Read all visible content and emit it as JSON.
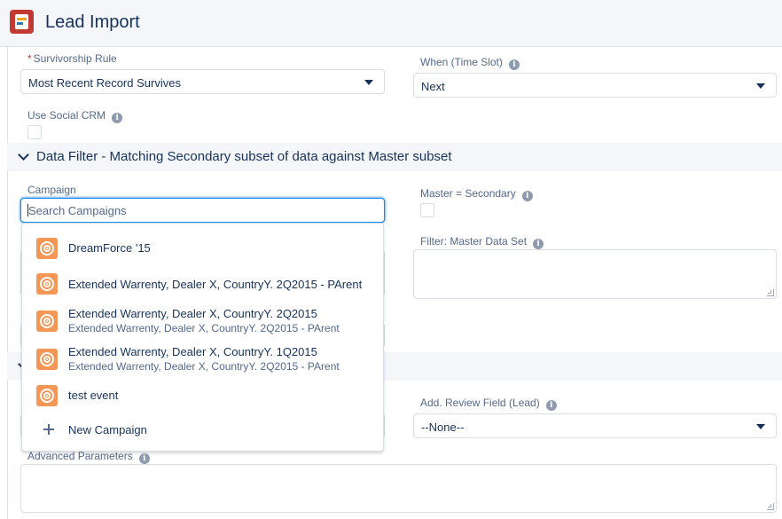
{
  "header": {
    "title": "Lead Import"
  },
  "survivorship": {
    "required_mark": "*",
    "label": "Survivorship Rule",
    "value": "Most Recent Record Survives"
  },
  "time_slot": {
    "label": "When (Time Slot)",
    "value": "Next"
  },
  "social": {
    "label": "Use Social CRM"
  },
  "data_filter": {
    "title": "Data Filter - Matching Secondary subset of data against Master subset"
  },
  "campaign": {
    "label": "Campaign",
    "placeholder": "Search Campaigns",
    "options": [
      {
        "title": "DreamForce '15",
        "subtitle": ""
      },
      {
        "title": "Extended Warrenty, Dealer X, CountryY. 2Q2015 - PArent",
        "subtitle": ""
      },
      {
        "title": "Extended Warrenty, Dealer X, CountryY. 2Q2015",
        "subtitle": "Extended Warrenty, Dealer X, CountryY. 2Q2015 - PArent"
      },
      {
        "title": "Extended Warrenty, Dealer X, CountryY. 1Q2015",
        "subtitle": "Extended Warrenty, Dealer X, CountryY. 2Q2015 - PArent"
      },
      {
        "title": "test event",
        "subtitle": ""
      }
    ],
    "new_label": "New Campaign"
  },
  "master_secondary": {
    "label": "Master = Secondary"
  },
  "filter_master": {
    "label": "Filter: Master Data Set"
  },
  "review_field": {
    "label": "Add. Review Field (Lead)",
    "value": "--None--"
  },
  "advanced": {
    "label": "Advanced Parameters"
  },
  "colors": {
    "accent": "#0070d2",
    "campaign_icon": "#f49756",
    "required": "#c23934"
  }
}
